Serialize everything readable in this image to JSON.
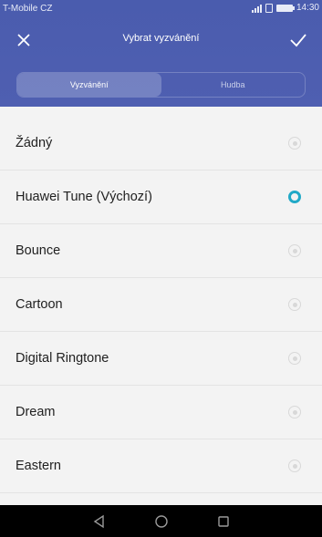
{
  "status_bar": {
    "carrier": "T-Mobile CZ",
    "time": "14:30"
  },
  "toolbar": {
    "title": "Vybrat vyzvánění",
    "close_icon": "close-icon",
    "confirm_icon": "check-icon"
  },
  "tabs": [
    {
      "label": "Vyzvánění",
      "active": true
    },
    {
      "label": "Hudba",
      "active": false
    }
  ],
  "ringtones": [
    {
      "label": "Žádný",
      "selected": false
    },
    {
      "label": "Huawei Tune (Výchozí)",
      "selected": true
    },
    {
      "label": "Bounce",
      "selected": false
    },
    {
      "label": "Cartoon",
      "selected": false
    },
    {
      "label": "Digital Ringtone",
      "selected": false
    },
    {
      "label": "Dream",
      "selected": false
    },
    {
      "label": "Eastern",
      "selected": false
    }
  ],
  "navigation": [
    "back-icon",
    "home-icon",
    "recents-icon"
  ],
  "colors": {
    "header": "#4e5eb0",
    "accent": "#21a9c7",
    "background": "#f3f3f3"
  }
}
